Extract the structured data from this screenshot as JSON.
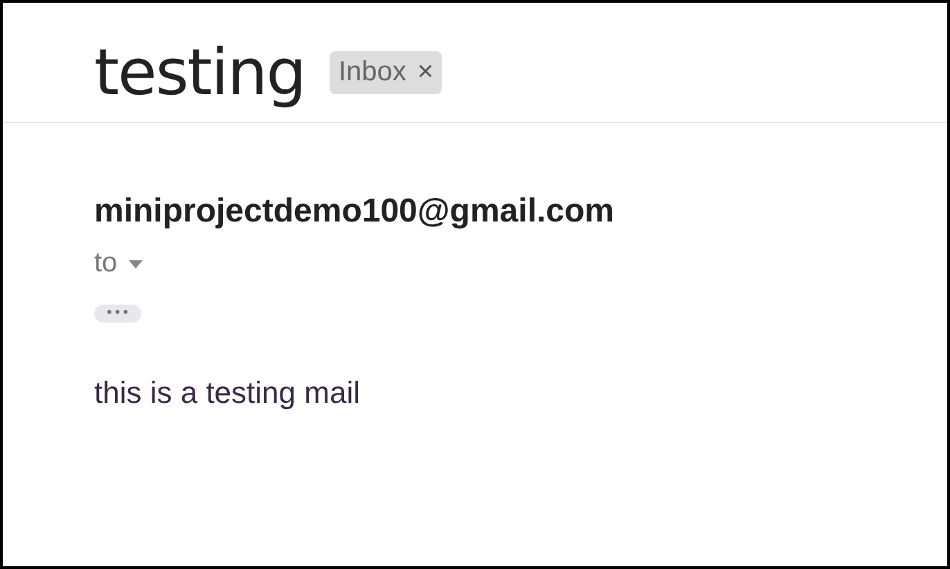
{
  "subject": "testing",
  "label": {
    "text": "Inbox",
    "close": "×"
  },
  "sender": "miniprojectdemo100@gmail.com",
  "recipient": {
    "text": "to"
  },
  "trimmed_content": {
    "text": "•••"
  },
  "body": "this is a testing mail"
}
